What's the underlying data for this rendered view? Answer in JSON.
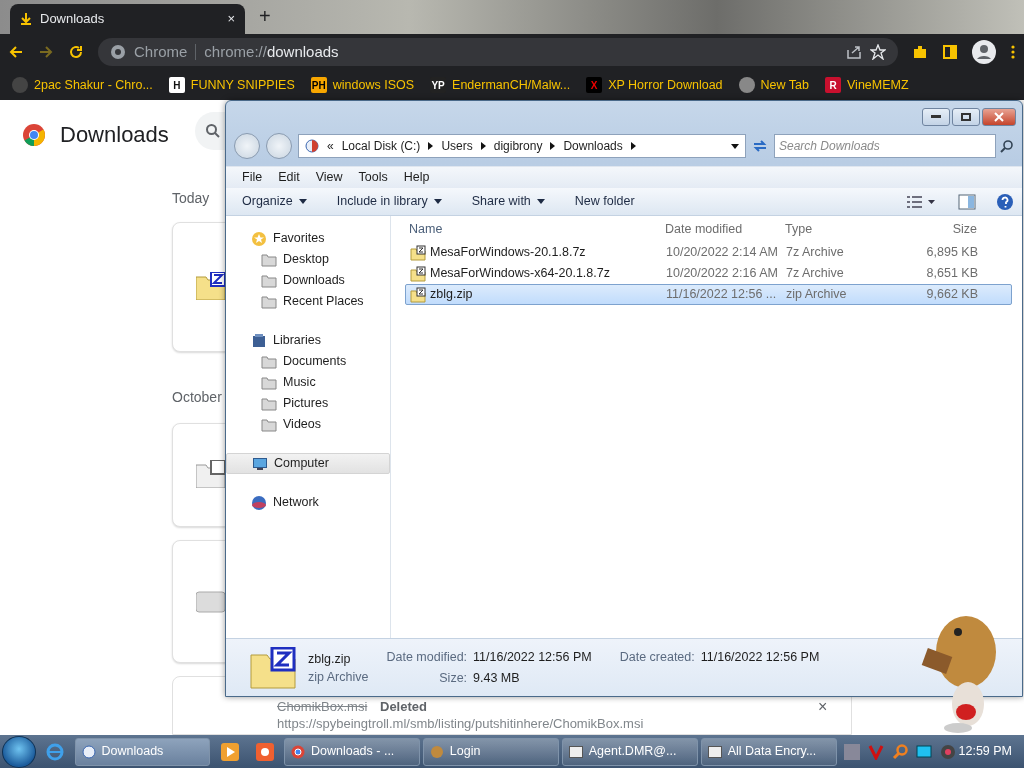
{
  "browser": {
    "tab": {
      "title": "Downloads",
      "selected": true,
      "close": "×"
    },
    "new_tab": "+",
    "chip": "Chrome",
    "url_prefix": "chrome://",
    "url_host": "downloads",
    "bookmarks": [
      {
        "label": "2pac Shakur - Chro..."
      },
      {
        "label": "FUNNY SNIPPIES",
        "icon_text": "H"
      },
      {
        "label": "windows ISOS",
        "icon_text": "PH"
      },
      {
        "label": "EndermanCH/Malw...",
        "icon_text": "YP"
      },
      {
        "label": "XP Horror Download",
        "icon_text": "X"
      },
      {
        "label": "New Tab"
      },
      {
        "label": "VineMEMZ",
        "icon_text": "R"
      }
    ]
  },
  "downloads_page": {
    "title": "Downloads",
    "sections": [
      {
        "heading": "Today"
      },
      {
        "heading": "October"
      }
    ],
    "bottom_item": {
      "file": "ChomikBox.msi",
      "status": "Deleted",
      "url": "https://spybeingtroll.ml/smb/listing/putshitinhere/ChomikBox.msi",
      "close": "×"
    }
  },
  "explorer": {
    "breadcrumb_prefix": "«",
    "breadcrumb": [
      "Local Disk (C:)",
      "Users",
      "digibrony",
      "Downloads"
    ],
    "search": {
      "placeholder": "Search Downloads"
    },
    "menu": [
      "File",
      "Edit",
      "View",
      "Tools",
      "Help"
    ],
    "toolbar": [
      {
        "label": "Organize",
        "dropdown": true
      },
      {
        "label": "Include in library",
        "dropdown": true
      },
      {
        "label": "Share with",
        "dropdown": true
      },
      {
        "label": "New folder",
        "dropdown": false
      }
    ],
    "nav": [
      {
        "label": "Favorites",
        "selected": false,
        "children": [
          {
            "label": "Desktop",
            "selected": false
          },
          {
            "label": "Downloads",
            "selected": false
          },
          {
            "label": "Recent Places",
            "selected": false
          }
        ]
      },
      {
        "label": "Libraries",
        "selected": false,
        "children": [
          {
            "label": "Documents",
            "selected": false
          },
          {
            "label": "Music",
            "selected": false
          },
          {
            "label": "Pictures",
            "selected": false
          },
          {
            "label": "Videos",
            "selected": false
          }
        ]
      },
      {
        "label": "Computer",
        "selected": true
      },
      {
        "label": "Network",
        "selected": false
      }
    ],
    "columns": [
      "Name",
      "Date modified",
      "Type",
      "Size"
    ],
    "files": [
      {
        "name": "MesaForWindows-20.1.8.7z",
        "date": "10/20/2022 2:14 AM",
        "type": "7z Archive",
        "size": "6,895 KB",
        "selected": false
      },
      {
        "name": "MesaForWindows-x64-20.1.8.7z",
        "date": "10/20/2022 2:16 AM",
        "type": "7z Archive",
        "size": "8,651 KB",
        "selected": false
      },
      {
        "name": "zblg.zip",
        "date": "11/16/2022 12:56 ...",
        "type": "zip Archive",
        "size": "9,662 KB",
        "selected": true
      }
    ],
    "details": {
      "name": "zblg.zip",
      "type": "zip Archive",
      "fields": [
        {
          "label": "Date modified:",
          "value": "11/16/2022 12:56 PM"
        },
        {
          "label": "Size:",
          "value": "9.43 MB"
        },
        {
          "label": "Date created:",
          "value": "11/16/2022 12:56 PM"
        }
      ]
    }
  },
  "taskbar": {
    "buttons": [
      {
        "label": "Downloads",
        "selected": true,
        "kind": "ie"
      },
      {
        "label": "Downloads - ...",
        "selected": false,
        "kind": "chrome"
      },
      {
        "label": "Login",
        "selected": false,
        "kind": "app"
      },
      {
        "label": "Agent.DMR@...",
        "selected": false,
        "kind": "window"
      },
      {
        "label": "All Data Encry...",
        "selected": false,
        "kind": "window"
      }
    ],
    "clock": "12:59 PM"
  }
}
